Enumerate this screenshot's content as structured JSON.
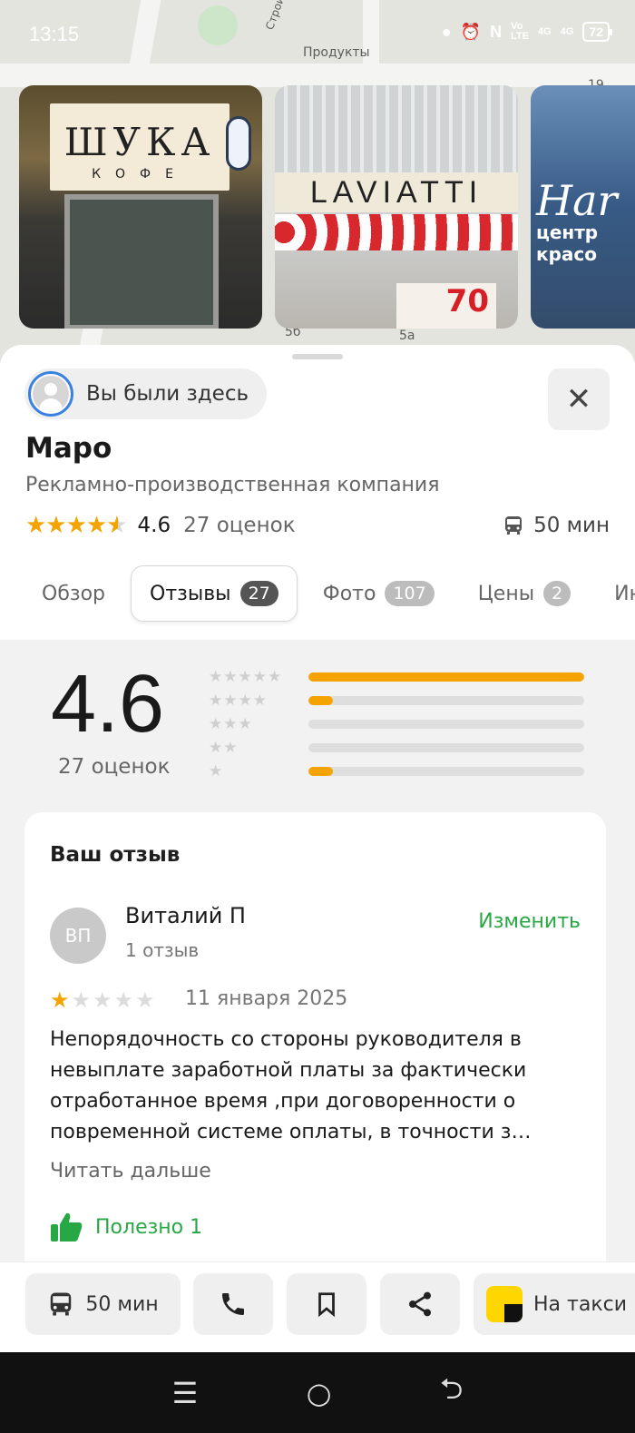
{
  "status_bar": {
    "time": "13:15",
    "volte": "Vo\nLTE",
    "net1": "4G",
    "net2": "4G",
    "battery": "72"
  },
  "map": {
    "labels": {
      "street": "Строителей",
      "shop": "Продукты",
      "b1": "5б",
      "b2": "5а",
      "b3": "19"
    }
  },
  "photos": [
    {
      "sign": "ШУКА",
      "sub": "КОФЕ"
    },
    {
      "brand": "LAVIATTI",
      "sale": "70"
    },
    {
      "brand": "Har",
      "sub": "центр красо"
    }
  ],
  "place": {
    "visited_label": "Вы были здесь",
    "name": "Маро",
    "category": "Рекламно-производственная компания",
    "rating": "4.6",
    "ratings_count": "27 оценок",
    "travel_time": "50 мин"
  },
  "tabs": [
    {
      "label": "Обзор",
      "badge": ""
    },
    {
      "label": "Отзывы",
      "badge": "27",
      "active": true
    },
    {
      "label": "Фото",
      "badge": "107"
    },
    {
      "label": "Цены",
      "badge": "2"
    },
    {
      "label": "Ин",
      "badge": ""
    }
  ],
  "summary": {
    "rating": "4.6",
    "count": "27 оценок",
    "distribution": [
      {
        "stars": 5,
        "fraction": 1.0
      },
      {
        "stars": 4,
        "fraction": 0.09
      },
      {
        "stars": 3,
        "fraction": 0.0
      },
      {
        "stars": 2,
        "fraction": 0.0
      },
      {
        "stars": 1,
        "fraction": 0.09
      }
    ]
  },
  "my_review": {
    "heading": "Ваш отзыв",
    "initials": "ВП",
    "author": "Виталий П",
    "author_reviews": "1 отзыв",
    "edit": "Изменить",
    "stars": 1,
    "date": "11 января 2025",
    "text": "Непорядочность со стороны руководителя в невыплате заработной платы за фактически отработанное время ,при договоренности о повременной системе оплаты, в точности з…",
    "read_more": "Читать дальше",
    "useful": "Полезно 1"
  },
  "actions": {
    "travel": "50 мин",
    "taxi": "На такси"
  },
  "colors": {
    "accent_star": "#f4a300",
    "green": "#27a844",
    "taxi_yellow": "#ffd600"
  }
}
